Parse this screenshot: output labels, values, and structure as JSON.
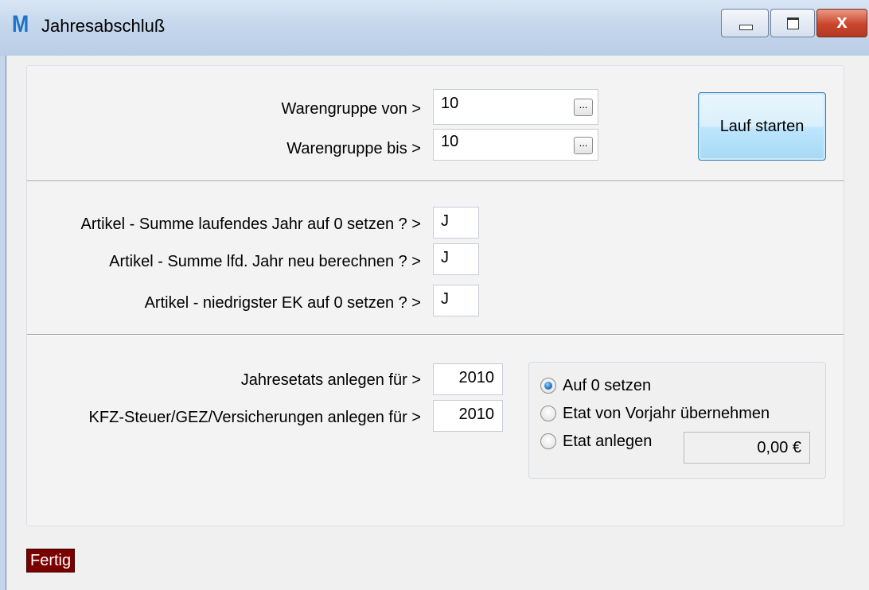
{
  "window": {
    "title": "Jahresabschluß",
    "logo_letter": "M",
    "close_glyph": "x"
  },
  "section1": {
    "from_label": "Warengruppe von >",
    "from_value": "10",
    "to_label": "Warengruppe bis >",
    "to_value": "10",
    "browse_label": "...",
    "start_button": "Lauf starten"
  },
  "section2": {
    "q1_label": "Artikel - Summe laufendes Jahr auf 0 setzen ? >",
    "q1_value": "J",
    "q2_label": "Artikel - Summe lfd. Jahr neu berechnen ? >",
    "q2_value": "J",
    "q3_label": "Artikel - niedrigster EK auf 0 setzen ? >",
    "q3_value": "J"
  },
  "section3": {
    "etat_label": "Jahresetats anlegen für >",
    "etat_year": "2010",
    "kfz_label": "KFZ-Steuer/GEZ/Versicherungen anlegen für >",
    "kfz_year": "2010",
    "options": [
      {
        "label": "Auf 0 setzen",
        "checked": true
      },
      {
        "label": "Etat von Vorjahr übernehmen",
        "checked": false
      },
      {
        "label": "Etat anlegen",
        "checked": false
      }
    ],
    "amount": "0,00 €"
  },
  "status": {
    "text": "Fertig",
    "color": "#7a0000"
  },
  "colors": {
    "titlebar": "#c5d7ec",
    "logo": "#1f73c8",
    "close_button": "#c9462c",
    "accent_radio": "#1e74c6"
  }
}
